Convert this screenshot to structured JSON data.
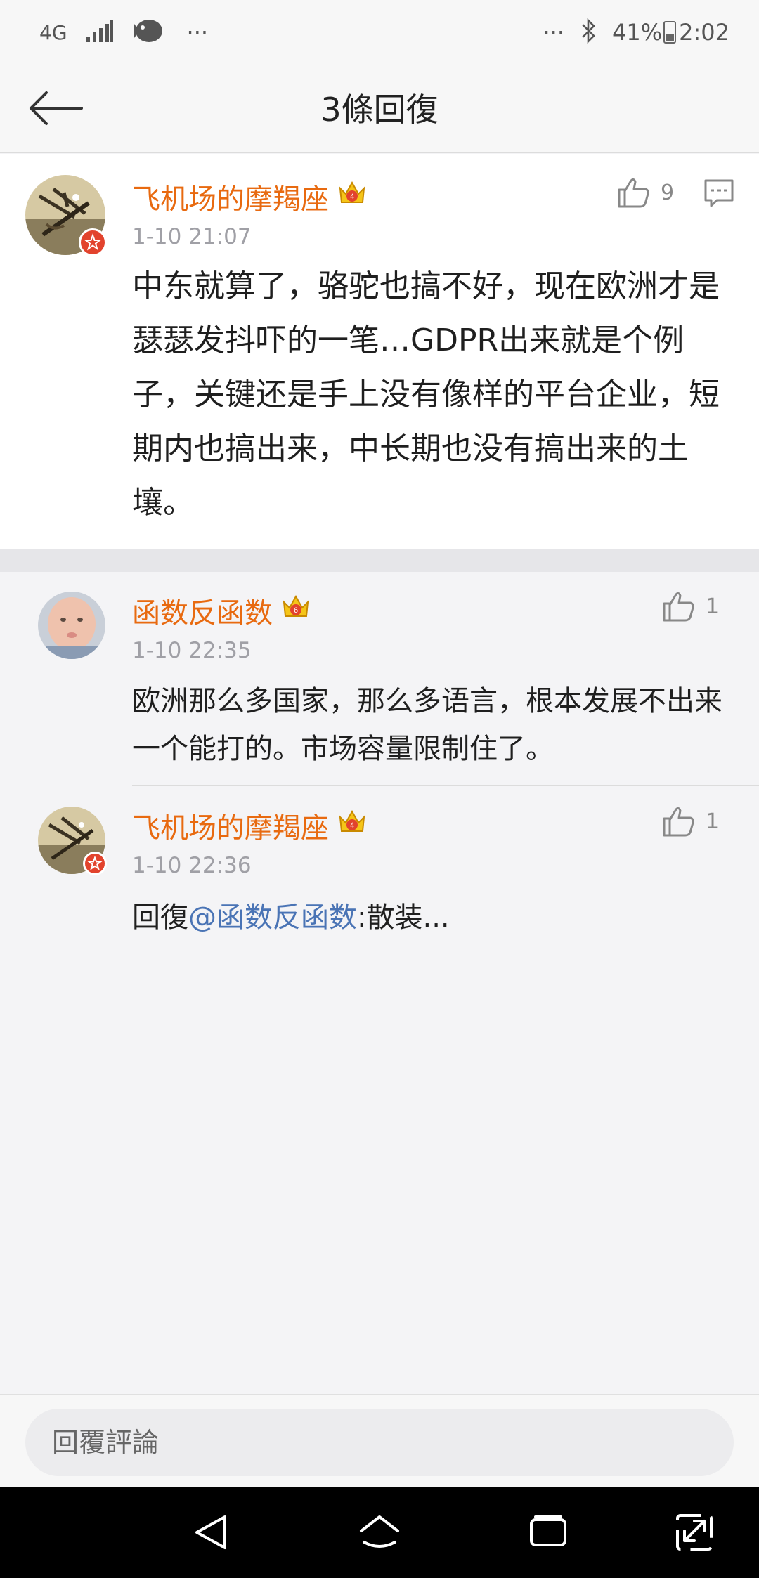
{
  "status_bar": {
    "network": "4G",
    "more": "···",
    "more_right": "···",
    "battery_percent": "41%",
    "battery_level": 0.41,
    "time": "2:02",
    "icons": [
      "signal-icon",
      "app-fish-icon",
      "bluetooth-icon",
      "battery-icon"
    ]
  },
  "header": {
    "title": "3條回復",
    "back_icon": "arrow-left-icon"
  },
  "main_comment": {
    "username": "飞机场的摩羯座",
    "timestamp": "1-10 21:07",
    "likes": "9",
    "text": "中东就算了，骆驼也搞不好，现在欧洲才是瑟瑟发抖吓的一笔…GDPR出来就是个例子，关键还是手上没有像样的平台企业，短期内也搞出来，中长期也没有搞出来的土壤。",
    "icons": [
      "thumbs-up-icon",
      "comment-icon",
      "vip-crown-icon"
    ]
  },
  "replies": [
    {
      "username": "函数反函数",
      "timestamp": "1-10 22:35",
      "likes": "1",
      "text": "欧洲那么多国家，那么多语言，根本发展不出来一个能打的。市场容量限制住了。"
    },
    {
      "username": "飞机场的摩羯座",
      "timestamp": "1-10 22:36",
      "likes": "1",
      "text_prefix": "回復",
      "mention": "@函数反函数",
      "text_suffix": ":散装..."
    }
  ],
  "input": {
    "placeholder": "回覆評論"
  },
  "colors": {
    "username": "#e86a10",
    "mention": "#4a74b5",
    "timestamp": "#a0a0a6",
    "badge": "#e2432d",
    "background": "#f4f4f6"
  }
}
